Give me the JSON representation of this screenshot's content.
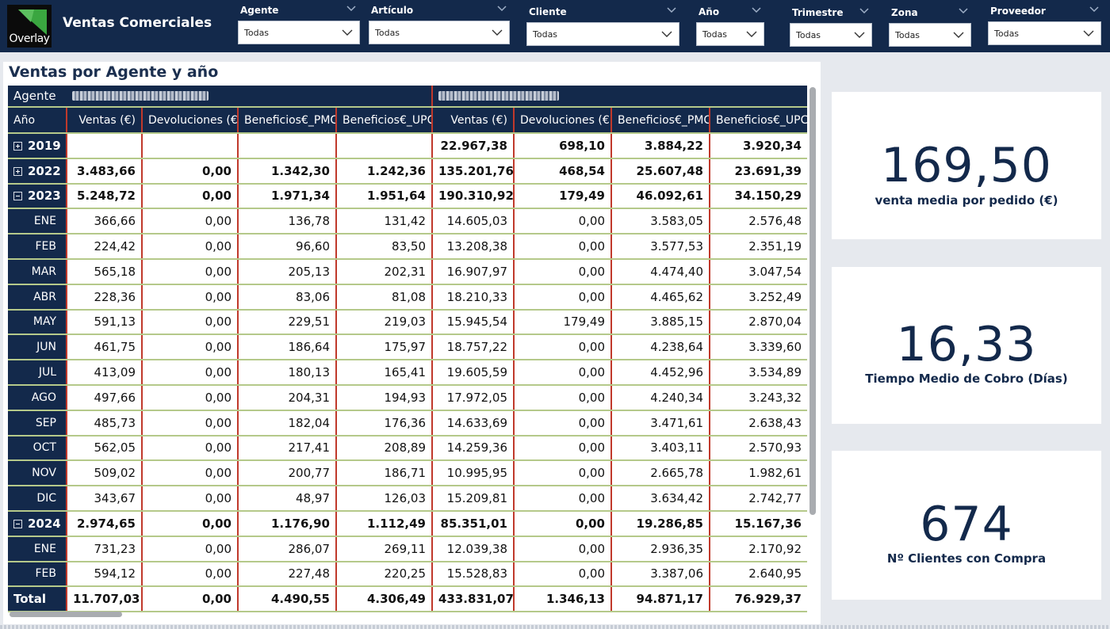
{
  "app": {
    "title": "Ventas Comerciales",
    "logo_text": "Overlay"
  },
  "filters": [
    {
      "label": "Agente",
      "value": "Todas"
    },
    {
      "label": "Artículo",
      "value": "Todas"
    },
    {
      "label": "Cliente",
      "value": "Todas"
    },
    {
      "label": "Año",
      "value": "Todas"
    },
    {
      "label": "Trimestre",
      "value": "Todas"
    },
    {
      "label": "Zona",
      "value": "Todas"
    },
    {
      "label": "Proveedor",
      "value": "Todas"
    }
  ],
  "matrix": {
    "title": "Ventas por Agente y año",
    "row_header_agent": "Agente",
    "row_header_year": "Año",
    "columns": [
      "Ventas (€)",
      "Devoluciones (€)",
      "Beneficios€_PMC",
      "Beneficios€_UPC",
      "Ventas (€)",
      "Devoluciones (€)",
      "Beneficios€_PMC",
      "Beneficios€_UPC"
    ],
    "rows": [
      {
        "label": "2019",
        "kind": "year",
        "expanded": false,
        "values": [
          "",
          "",
          "",
          "",
          "22.967,38",
          "698,10",
          "3.884,22",
          "3.920,34"
        ]
      },
      {
        "label": "2022",
        "kind": "year",
        "expanded": false,
        "values": [
          "3.483,66",
          "0,00",
          "1.342,30",
          "1.242,36",
          "135.201,76",
          "468,54",
          "25.607,48",
          "23.691,39"
        ]
      },
      {
        "label": "2023",
        "kind": "year",
        "expanded": true,
        "values": [
          "5.248,72",
          "0,00",
          "1.971,34",
          "1.951,64",
          "190.310,92",
          "179,49",
          "46.092,61",
          "34.150,29"
        ]
      },
      {
        "label": "ENE",
        "kind": "month",
        "values": [
          "366,66",
          "0,00",
          "136,78",
          "131,42",
          "14.605,03",
          "0,00",
          "3.583,05",
          "2.576,48"
        ]
      },
      {
        "label": "FEB",
        "kind": "month",
        "values": [
          "224,42",
          "0,00",
          "96,60",
          "83,50",
          "13.208,38",
          "0,00",
          "3.577,53",
          "2.351,19"
        ]
      },
      {
        "label": "MAR",
        "kind": "month",
        "values": [
          "565,18",
          "0,00",
          "205,13",
          "202,31",
          "16.907,97",
          "0,00",
          "4.474,40",
          "3.047,54"
        ]
      },
      {
        "label": "ABR",
        "kind": "month",
        "values": [
          "228,36",
          "0,00",
          "83,06",
          "81,08",
          "18.210,33",
          "0,00",
          "4.465,62",
          "3.252,49"
        ]
      },
      {
        "label": "MAY",
        "kind": "month",
        "values": [
          "591,13",
          "0,00",
          "229,51",
          "219,03",
          "15.945,54",
          "179,49",
          "3.885,15",
          "2.870,04"
        ]
      },
      {
        "label": "JUN",
        "kind": "month",
        "values": [
          "461,75",
          "0,00",
          "186,64",
          "175,97",
          "18.757,22",
          "0,00",
          "4.238,64",
          "3.339,60"
        ]
      },
      {
        "label": "JUL",
        "kind": "month",
        "values": [
          "413,09",
          "0,00",
          "180,13",
          "165,41",
          "19.605,59",
          "0,00",
          "4.452,96",
          "3.534,89"
        ]
      },
      {
        "label": "AGO",
        "kind": "month",
        "values": [
          "497,66",
          "0,00",
          "204,31",
          "194,93",
          "17.972,05",
          "0,00",
          "4.240,34",
          "3.243,32"
        ]
      },
      {
        "label": "SEP",
        "kind": "month",
        "values": [
          "485,73",
          "0,00",
          "182,04",
          "176,36",
          "14.633,69",
          "0,00",
          "3.471,61",
          "2.638,43"
        ]
      },
      {
        "label": "OCT",
        "kind": "month",
        "values": [
          "562,05",
          "0,00",
          "217,41",
          "208,89",
          "14.259,36",
          "0,00",
          "3.403,11",
          "2.570,93"
        ]
      },
      {
        "label": "NOV",
        "kind": "month",
        "values": [
          "509,02",
          "0,00",
          "200,77",
          "186,71",
          "10.995,95",
          "0,00",
          "2.665,78",
          "1.982,61"
        ]
      },
      {
        "label": "DIC",
        "kind": "month",
        "values": [
          "343,67",
          "0,00",
          "48,97",
          "126,03",
          "15.209,81",
          "0,00",
          "3.634,42",
          "2.742,77"
        ]
      },
      {
        "label": "2024",
        "kind": "year",
        "expanded": true,
        "values": [
          "2.974,65",
          "0,00",
          "1.176,90",
          "1.112,49",
          "85.351,01",
          "0,00",
          "19.286,85",
          "15.167,36"
        ]
      },
      {
        "label": "ENE",
        "kind": "month",
        "values": [
          "731,23",
          "0,00",
          "286,07",
          "269,11",
          "12.039,38",
          "0,00",
          "2.936,35",
          "2.170,92"
        ]
      },
      {
        "label": "FEB",
        "kind": "month",
        "values": [
          "594,12",
          "0,00",
          "227,48",
          "220,25",
          "15.528,83",
          "0,00",
          "3.387,06",
          "2.640,95"
        ]
      },
      {
        "label": "Total",
        "kind": "total",
        "values": [
          "11.707,03",
          "0,00",
          "4.490,55",
          "4.306,49",
          "433.831,07",
          "1.346,13",
          "94.871,17",
          "76.929,37"
        ]
      }
    ]
  },
  "cards": [
    {
      "value": "169,50",
      "label": "venta media por pedido (€)"
    },
    {
      "value": "16,33",
      "label": "Tiempo Medio de Cobro (Días)"
    },
    {
      "value": "674",
      "label": "Nº Clientes con Compra"
    }
  ],
  "colors": {
    "navy": "#13294b",
    "row_line": "#b5c98a",
    "group_line": "#c0392b"
  }
}
